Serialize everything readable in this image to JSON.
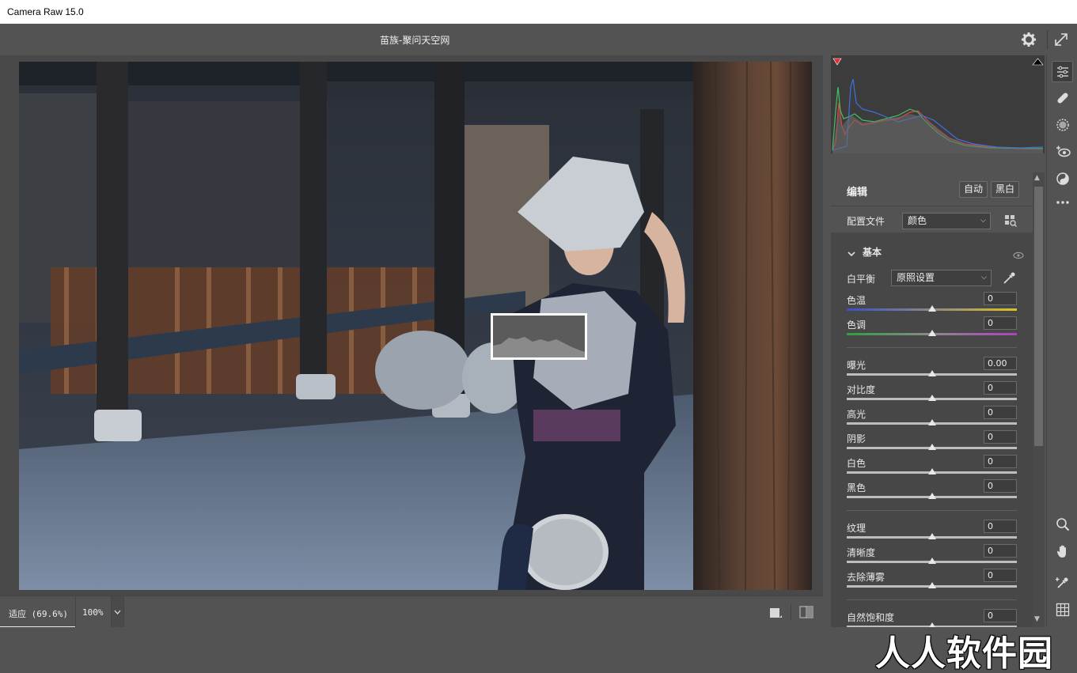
{
  "window": {
    "title": "Camera Raw 15.0"
  },
  "header": {
    "doc_title": "苗族-聚问天空网"
  },
  "bottom": {
    "zoom_fit": "适应 (69.6%)",
    "zoom_100": "100%"
  },
  "panel": {
    "edit_title": "编辑",
    "auto_label": "自动",
    "bw_label": "黑白",
    "profile_label": "配置文件",
    "profile_value": "颜色",
    "basic_title": "基本",
    "wb_label": "白平衡",
    "wb_value": "原照设置",
    "sliders": [
      {
        "label": "色温",
        "value": "0",
        "position": 0.5
      },
      {
        "label": "色调",
        "value": "0",
        "position": 0.5
      },
      {
        "label": "曝光",
        "value": "0.00",
        "position": 0.5
      },
      {
        "label": "对比度",
        "value": "0",
        "position": 0.5
      },
      {
        "label": "高光",
        "value": "0",
        "position": 0.5
      },
      {
        "label": "阴影",
        "value": "0",
        "position": 0.5
      },
      {
        "label": "白色",
        "value": "0",
        "position": 0.5
      },
      {
        "label": "黑色",
        "value": "0",
        "position": 0.5
      },
      {
        "label": "纹理",
        "value": "0",
        "position": 0.5
      },
      {
        "label": "清晰度",
        "value": "0",
        "position": 0.5
      },
      {
        "label": "去除薄雾",
        "value": "0",
        "position": 0.5
      },
      {
        "label": "自然饱和度",
        "value": "0",
        "position": 0.5
      }
    ]
  },
  "toolbar": {
    "tools": [
      "edit-sliders-icon",
      "healing-icon",
      "mask-icon",
      "red-eye-icon",
      "presets-icon",
      "more-icon"
    ],
    "bottom_tools": [
      "zoom-icon",
      "hand-icon",
      "color-sampler-icon",
      "grid-icon"
    ]
  },
  "watermark": "人人软件园",
  "colors": {
    "background": "#535353",
    "panel": "#474747",
    "canvas": "#494949",
    "clip_warning": "#e03030"
  }
}
